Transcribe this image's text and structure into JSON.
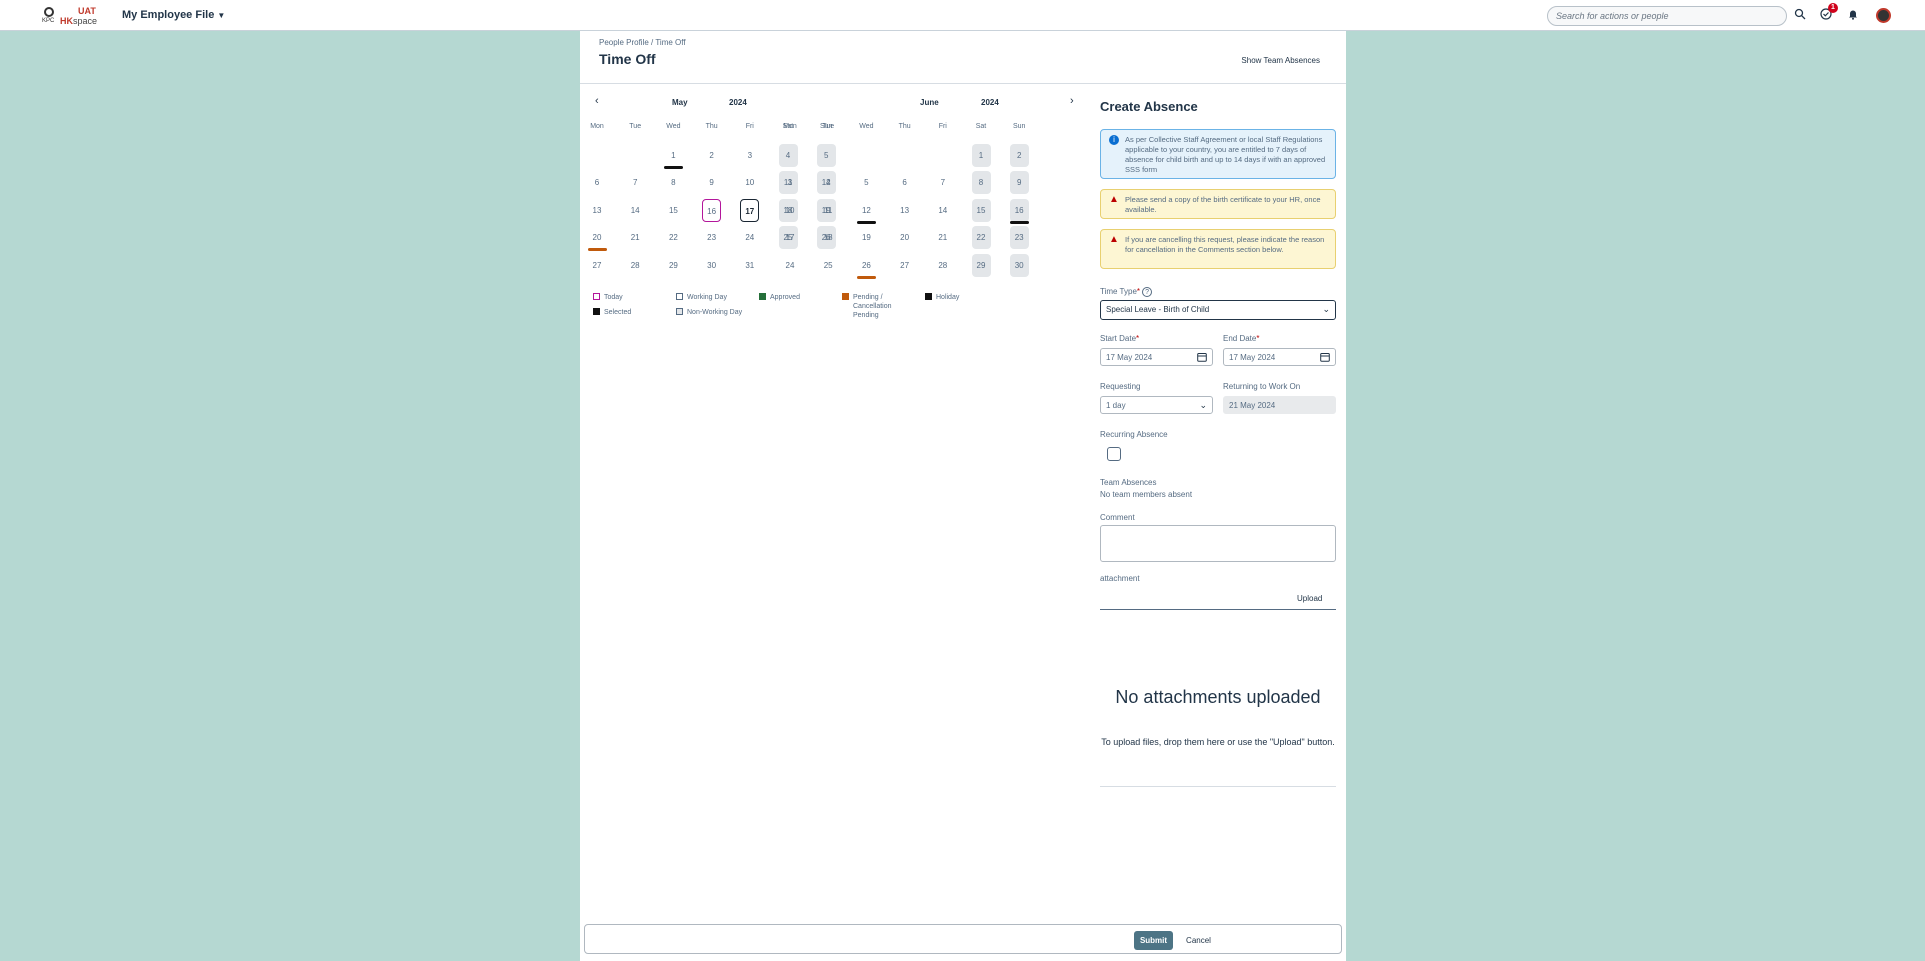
{
  "topbar": {
    "logo_kpc": "KPC",
    "logo_uat": "UAT",
    "logo_hk": "HK",
    "logo_space": "space",
    "app_title": "My Employee File",
    "search_placeholder": "Search for actions or people",
    "notification_count": "1"
  },
  "page": {
    "breadcrumb": "People Profile / Time Off",
    "title": "Time Off",
    "show_team_absences": "Show Team Absences"
  },
  "calendar": {
    "prev": "‹",
    "next": "›",
    "may": {
      "month": "May",
      "year": "2024"
    },
    "june": {
      "month": "June",
      "year": "2024"
    },
    "weekdays": [
      "Mon",
      "Tue",
      "Wed",
      "Thu",
      "Fri",
      "Sat",
      "Sun"
    ],
    "may_days": [
      "1",
      "2",
      "3",
      "4",
      "5",
      "6",
      "7",
      "8",
      "9",
      "10",
      "11",
      "12",
      "13",
      "14",
      "15",
      "16",
      "17",
      "18",
      "19",
      "20",
      "21",
      "22",
      "23",
      "24",
      "25",
      "26",
      "27",
      "28",
      "29",
      "30",
      "31"
    ],
    "june_days": [
      "1",
      "2",
      "3",
      "4",
      "5",
      "6",
      "7",
      "8",
      "9",
      "10",
      "11",
      "12",
      "13",
      "14",
      "15",
      "16",
      "17",
      "18",
      "19",
      "20",
      "21",
      "22",
      "23",
      "24",
      "25",
      "26",
      "27",
      "28",
      "29",
      "30"
    ]
  },
  "legend": {
    "today": "Today",
    "working_day": "Working Day",
    "approved": "Approved",
    "pending": "Pending / Cancellation Pending",
    "holiday": "Holiday",
    "selected": "Selected",
    "non_working_day": "Non-Working Day",
    "colors": {
      "today": "#b3169b",
      "approved": "#256f3a",
      "pending": "#c05a0c",
      "holiday": "#111111",
      "selected": "#111111"
    }
  },
  "form": {
    "title": "Create Absence",
    "info_msg": "As per Collective Staff Agreement or local Staff Regulations applicable to your country, you are entitled to 7 days of absence for child birth and up to 14 days if with an approved SSS form",
    "warn_msg_1": "Please send a copy of the birth certificate to your HR, once available.",
    "warn_msg_2": "If you are cancelling this request, please indicate the reason for cancellation in the Comments section below.",
    "time_type_label": "Time Type",
    "time_type_value": "Special Leave - Birth of Child",
    "start_date_label": "Start Date",
    "start_date_value": "17 May 2024",
    "end_date_label": "End Date",
    "end_date_value": "17 May 2024",
    "requesting_label": "Requesting",
    "requesting_value": "1 day",
    "returning_label": "Returning to Work On",
    "returning_value": "21 May 2024",
    "recurring_label": "Recurring Absence",
    "team_absences_label": "Team Absences",
    "team_absences_value": "No team members absent",
    "comment_label": "Comment",
    "attachment_label": "attachment",
    "upload": "Upload",
    "no_attachments": "No attachments uploaded",
    "no_attachments_sub": "To upload files, drop them here or use the \"Upload\" button."
  },
  "footer": {
    "submit": "Submit",
    "cancel": "Cancel"
  }
}
